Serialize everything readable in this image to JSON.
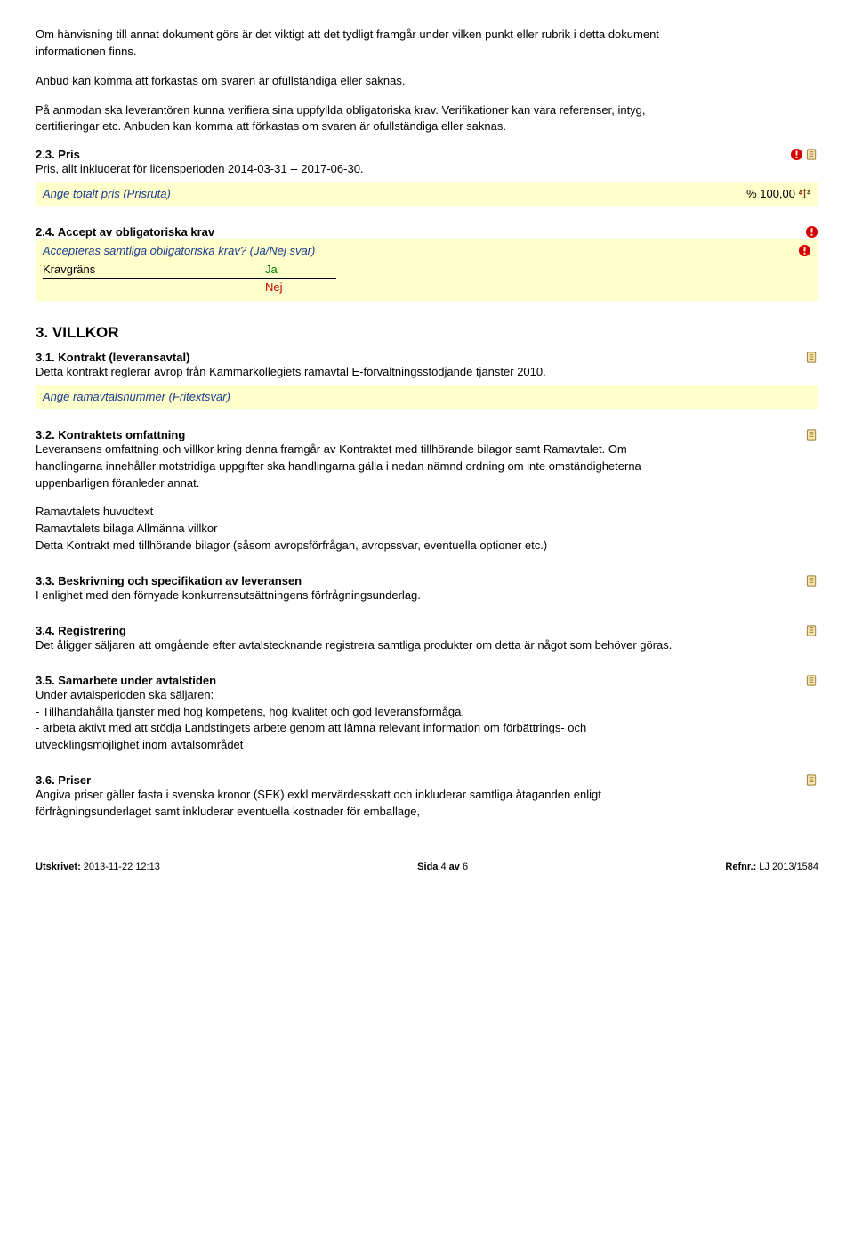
{
  "intro": {
    "p1": "Om hänvisning till annat dokument görs är det viktigt att det tydligt framgår under vilken punkt eller rubrik i detta dokument informationen finns.",
    "p2": "Anbud kan komma att förkastas om svaren är ofullständiga eller saknas.",
    "p3": "På anmodan ska leverantören kunna verifiera sina uppfyllda obligatoriska krav. Verifikationer kan vara referenser, intyg, certifieringar etc. Anbuden kan komma att förkastas om svaren är ofullständiga eller saknas."
  },
  "s23": {
    "heading": "2.3. Pris",
    "body": "Pris, allt inkluderat för licensperioden 2014-03-31 -- 2017-06-30.",
    "hl_label": "Ange totalt pris (Prisruta)",
    "hl_value": "% 100,00"
  },
  "s24": {
    "heading": "2.4. Accept av obligatoriska krav",
    "question": "Accepteras samtliga obligatoriska krav? (Ja/Nej svar)",
    "row_label": "Kravgräns",
    "ja": "Ja",
    "nej": "Nej"
  },
  "villkor": {
    "heading": "3. VILLKOR"
  },
  "s31": {
    "heading": "3.1. Kontrakt (leveransavtal)",
    "body": "Detta kontrakt reglerar avrop från Kammarkollegiets ramavtal E-förvaltningsstödjande tjänster 2010.",
    "hl_label": "Ange ramavtalsnummer (Fritextsvar)"
  },
  "s32": {
    "heading": "3.2. Kontraktets omfattning",
    "body1": "Leveransens omfattning och villkor kring denna framgår av Kontraktet med tillhörande bilagor samt Ramavtalet. Om handlingarna innehåller motstridiga uppgifter ska handlingarna gälla i nedan nämnd ordning om inte omständigheterna uppenbarligen föranleder annat.",
    "l1": "Ramavtalets huvudtext",
    "l2": "Ramavtalets bilaga Allmänna villkor",
    "l3": "Detta Kontrakt med tillhörande bilagor (såsom avropsförfrågan, avropssvar, eventuella optioner etc.)"
  },
  "s33": {
    "heading": "3.3. Beskrivning och specifikation av leveransen",
    "body": "I enlighet med den förnyade konkurrensutsättningens förfrågningsunderlag."
  },
  "s34": {
    "heading": "3.4. Registrering",
    "body": "Det åligger säljaren att omgående efter avtalstecknande registrera samtliga produkter om detta är något som behöver göras."
  },
  "s35": {
    "heading": "3.5. Samarbete under avtalstiden",
    "l1": "Under avtalsperioden ska säljaren:",
    "l2": "- Tillhandahålla tjänster med hög kompetens, hög kvalitet och god leveransförmåga,",
    "l3": "- arbeta aktivt med att stödja Landstingets arbete genom att lämna relevant information om förbättrings- och utvecklingsmöjlighet inom avtalsområdet"
  },
  "s36": {
    "heading": "3.6. Priser",
    "body": "Angiva priser gäller fasta i svenska kronor (SEK) exkl mervärdesskatt och inkluderar samtliga åtaganden enligt förfrågningsunderlaget samt inkluderar eventuella kostnader för emballage,"
  },
  "footer": {
    "left_label": "Utskrivet:",
    "left_val": " 2013-11-22 12:13",
    "mid_label": "Sida",
    "mid_val1": " 4 ",
    "mid_av": "av",
    "mid_val2": " 6",
    "right_label": "Refnr.:",
    "right_val": " LJ 2013/1584"
  }
}
